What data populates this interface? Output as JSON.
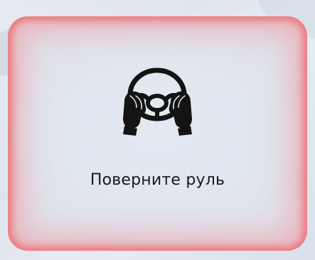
{
  "alert": {
    "icon": "steering-wheel-hands-icon",
    "message": "Поверните руль"
  },
  "colors": {
    "background": "#dfe5ee",
    "warning_glow": "#ec767b",
    "text": "#1a1a1a",
    "icon": "#141414"
  }
}
